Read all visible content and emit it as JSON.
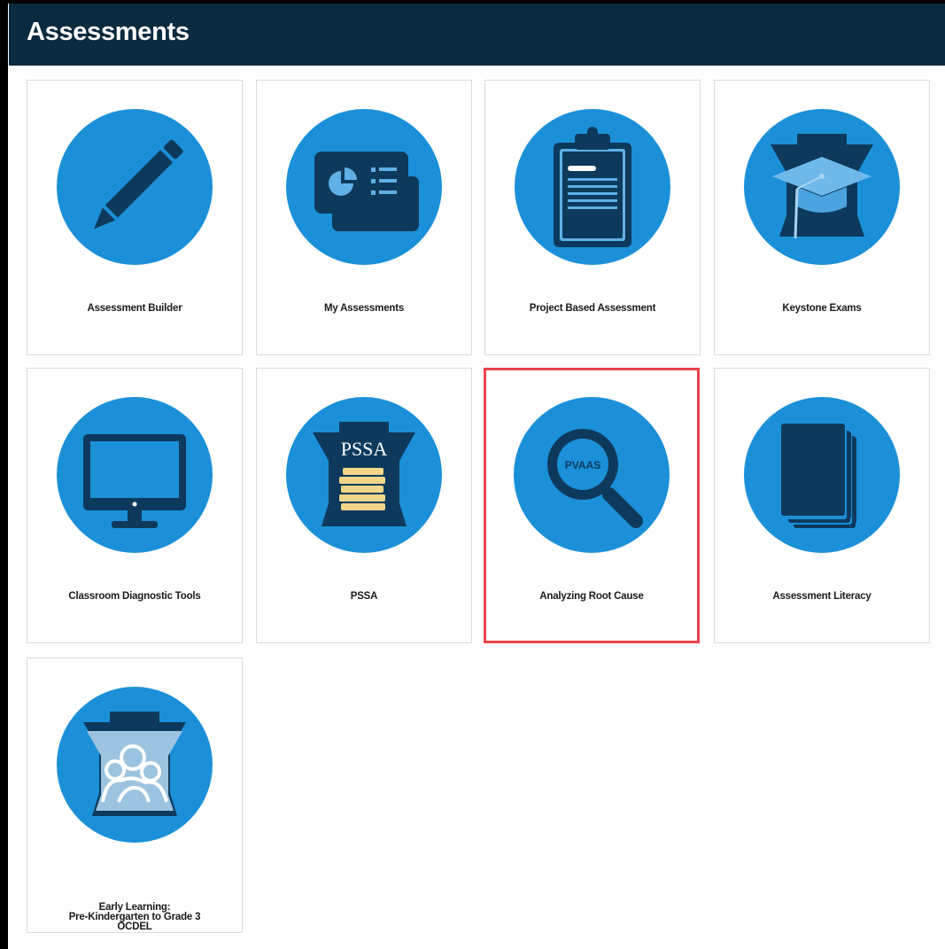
{
  "page": {
    "title": "Assessments"
  },
  "tiles": [
    {
      "label": "Assessment Builder",
      "icon": "pencil-icon"
    },
    {
      "label": "My Assessments",
      "icon": "presentation-cards-icon"
    },
    {
      "label": "Project Based Assessment",
      "icon": "clipboard-icon"
    },
    {
      "label": "Keystone Exams",
      "icon": "keystone-graduation-cap-icon"
    },
    {
      "label": "Classroom Diagnostic Tools",
      "icon": "computer-monitor-icon"
    },
    {
      "label": "PSSA",
      "icon": "pssa-keystone-books-icon",
      "icon_text": "PSSA"
    },
    {
      "label": "Analyzing Root Cause",
      "icon": "pvaas-magnifier-icon",
      "icon_text": "PVAAS",
      "selected": true
    },
    {
      "label": "Assessment Literacy",
      "icon": "books-stack-icon"
    },
    {
      "label": "Early Learning:\nPre-Kindergarten to Grade 3\nOCDEL",
      "icon": "keystone-family-icon"
    }
  ],
  "colors": {
    "header_bg": "#0a2a3f",
    "circle": "#1b90d9",
    "icon_dark": "#0d3a5c",
    "selected_border": "#e8454a",
    "books_yellow": "#f2d687"
  }
}
